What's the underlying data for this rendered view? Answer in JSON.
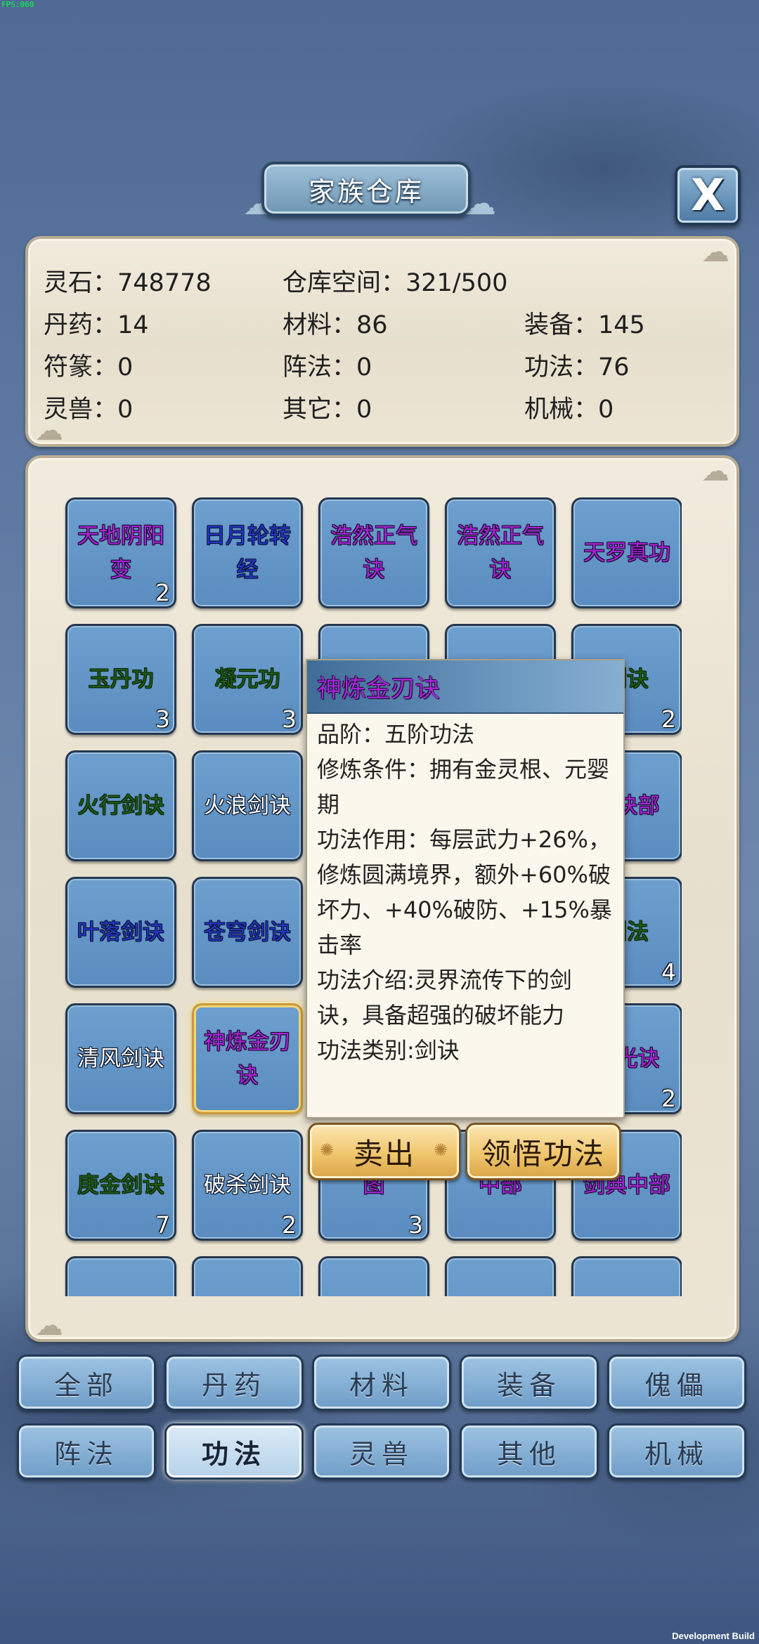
{
  "overlay": {
    "fps": "FPS:060",
    "dev_build": "Development Build"
  },
  "header": {
    "title": "家族仓库",
    "close_label": "X"
  },
  "stats": {
    "lingshi": {
      "label": "灵石：",
      "value": "748778"
    },
    "space": {
      "label": "仓库空间：",
      "value": "321/500"
    },
    "danyao": {
      "label": "丹药：",
      "value": "14"
    },
    "cailiao": {
      "label": "材料：",
      "value": "86"
    },
    "zhuangbei": {
      "label": "装备：",
      "value": "145"
    },
    "fuzhuan": {
      "label": "符篆：",
      "value": "0"
    },
    "zhenfa": {
      "label": "阵法：",
      "value": "0"
    },
    "gongfa": {
      "label": "功法：",
      "value": "76"
    },
    "lingshou": {
      "label": "灵兽：",
      "value": "0"
    },
    "qita": {
      "label": "其它：",
      "value": "0"
    },
    "jixie": {
      "label": "机械：",
      "value": "0"
    }
  },
  "items": [
    {
      "name": "天地阴阳变",
      "quality": "purple",
      "count": "2"
    },
    {
      "name": "日月轮转经",
      "quality": "blue",
      "count": ""
    },
    {
      "name": "浩然正气诀",
      "quality": "purple",
      "count": ""
    },
    {
      "name": "浩然正气诀",
      "quality": "purple",
      "count": ""
    },
    {
      "name": "天罗真功",
      "quality": "purple",
      "count": ""
    },
    {
      "name": "玉丹功",
      "quality": "green",
      "count": "3"
    },
    {
      "name": "凝元功",
      "quality": "green",
      "count": "3"
    },
    {
      "name": "",
      "quality": "none",
      "count": ""
    },
    {
      "name": "",
      "quality": "none",
      "count": ""
    },
    {
      "name": "剑诀",
      "quality": "green",
      "count": "2"
    },
    {
      "name": "火行剑诀",
      "quality": "green",
      "count": ""
    },
    {
      "name": "火浪剑诀",
      "quality": "white",
      "count": ""
    },
    {
      "name": "",
      "quality": "none",
      "count": ""
    },
    {
      "name": "",
      "quality": "none",
      "count": ""
    },
    {
      "name": "剑诀部",
      "quality": "purple",
      "count": ""
    },
    {
      "name": "叶落剑诀",
      "quality": "blue",
      "count": ""
    },
    {
      "name": "苍穹剑诀",
      "quality": "blue",
      "count": ""
    },
    {
      "name": "",
      "quality": "none",
      "count": ""
    },
    {
      "name": "",
      "quality": "none",
      "count": ""
    },
    {
      "name": "剑法",
      "quality": "green",
      "count": "4"
    },
    {
      "name": "清风剑诀",
      "quality": "white",
      "count": ""
    },
    {
      "name": "神炼金刃诀",
      "quality": "purple",
      "count": "",
      "selected": true
    },
    {
      "name": "",
      "quality": "none",
      "count": ""
    },
    {
      "name": "",
      "quality": "none",
      "count": ""
    },
    {
      "name": "分光诀",
      "quality": "purple",
      "count": "2"
    },
    {
      "name": "庚金剑诀",
      "quality": "green",
      "count": "7"
    },
    {
      "name": "破杀剑诀",
      "quality": "white",
      "count": "2"
    },
    {
      "name": "图",
      "quality": "purple",
      "count": "3"
    },
    {
      "name": "中部",
      "quality": "purple",
      "count": ""
    },
    {
      "name": "剑典中部",
      "quality": "purple",
      "count": ""
    },
    {
      "name": "",
      "quality": "none",
      "count": ""
    },
    {
      "name": "",
      "quality": "none",
      "count": ""
    },
    {
      "name": "",
      "quality": "none",
      "count": ""
    },
    {
      "name": "",
      "quality": "none",
      "count": ""
    },
    {
      "name": "",
      "quality": "none",
      "count": ""
    }
  ],
  "tooltip": {
    "title": "神炼金刃诀",
    "lines": [
      "品阶：五阶功法",
      "修炼条件：拥有金灵根、元婴期",
      "功法作用：每层武力+26%，修炼圆满境界，额外+60%破坏力、+40%破防、+15%暴击率",
      "功法介绍:灵界流传下的剑诀，具备超强的破坏能力",
      "功法类别:剑诀"
    ],
    "sell_label": "卖出",
    "learn_label": "领悟功法"
  },
  "tabs": [
    {
      "label": "全部",
      "active": false
    },
    {
      "label": "丹药",
      "active": false
    },
    {
      "label": "材料",
      "active": false
    },
    {
      "label": "装备",
      "active": false
    },
    {
      "label": "傀儡",
      "active": false
    },
    {
      "label": "阵法",
      "active": false
    },
    {
      "label": "功法",
      "active": true
    },
    {
      "label": "灵兽",
      "active": false
    },
    {
      "label": "其他",
      "active": false
    },
    {
      "label": "机械",
      "active": false
    }
  ]
}
